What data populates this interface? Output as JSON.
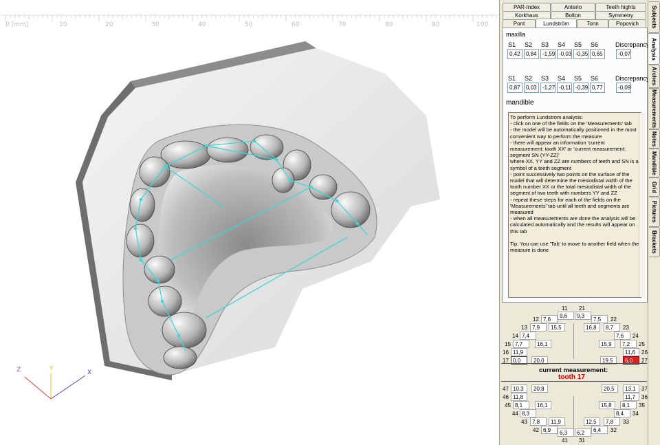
{
  "ruler": {
    "labels": [
      "0 [mm]",
      "10",
      "20",
      "30",
      "40",
      "50",
      "60",
      "70",
      "80",
      "90",
      "100"
    ]
  },
  "axes": {
    "z": "Z",
    "y": "Y",
    "x": "X"
  },
  "colors": {
    "panel_bg": "#ece9d8",
    "measure_line": "#3fd6d9",
    "highlight": "#e31b1b",
    "current_tooth": "#d00000"
  },
  "top_tabs": {
    "row1": [
      "PAR-Index",
      "Anterio",
      "Teeth hights"
    ],
    "row2": [
      "Korkhaus",
      "Bolton",
      "Symmetry"
    ],
    "row3": [
      "Pont",
      "Lundström",
      "Tonn",
      "Popovich"
    ]
  },
  "side_tabs": [
    "Subjects",
    "Analysis",
    "Arches",
    "Measurements",
    "Notes",
    "Mandible",
    "Grid",
    "Pictures",
    "Brackets"
  ],
  "maxilla": {
    "title": "maxilla",
    "headers": [
      "S1",
      "S2",
      "S3",
      "S4",
      "S5",
      "S6"
    ],
    "values": [
      "0,42",
      "0,84",
      "-1,59",
      "-0,03",
      "-0,35",
      "0,65"
    ],
    "discrepancy_label": "Discrepancy",
    "discrepancy": "-0,07"
  },
  "mandible_row": {
    "headers": [
      "S1",
      "S2",
      "S3",
      "S4",
      "S5",
      "S6"
    ],
    "values": [
      "0,87",
      "0,03",
      "-1,27",
      "-0,11",
      "-0,39",
      "0,77"
    ],
    "discrepancy_label": "Discrepancy",
    "discrepancy": "-0,09"
  },
  "mandible_title": "mandible",
  "instructions": "To perform Lundstrom analysis:\n- click on one of the fields on the 'Measurements' tab\n- the model will be automatically positioned in the most convenient way to perform the measure\n- there will appear an information 'current measurement: tooth XX' or 'current measurement: segment SN (YY-ZZ)'\nwhere XX, YY and ZZ are numbers of teeth and SN is a symbol of a teeth segment\n- point successively two points on the surface of the model that will determine the mesiodistal width of the tooth number XX or the total mesiodistal width of the segment of two teeth with numbers YY and ZZ\n- repeat these steps for each of the fields on the 'Measurements' tab until all teeth and segments are measured\n- when all measurements are done the analysis will be calculated automatically and the results will appear on this tab\n\nTip: You can use 'Tab' to move to another field when the measure is done",
  "upper_teeth": {
    "t11": "11",
    "t21": "21",
    "v11": "9,6",
    "v21": "9,3",
    "t12": "12",
    "v12": "7,6",
    "v22": "7,5",
    "t22": "22",
    "t13": "13",
    "v13": "7,9",
    "s13": "15,5",
    "s23": "16,8",
    "v23": "8,7",
    "t23": "23",
    "t14": "14",
    "v14": "7,4",
    "v24": "7,6",
    "t24": "24",
    "t15": "15",
    "v15": "7,7",
    "s15": "16,1",
    "s25": "15,9",
    "v25": "7,2",
    "t25": "25",
    "t16": "16",
    "v16": "11,9",
    "v26": "11,6",
    "t26": "26",
    "t17": "17",
    "v17": "0,0",
    "s17": "20,0",
    "s27": "19,5",
    "v27": "6,0",
    "t27": "27"
  },
  "current": {
    "label": "current measurement:",
    "value": "tooth 17"
  },
  "lower_teeth": {
    "t47": "47",
    "v47": "10,3",
    "s47": "20,8",
    "s37": "20,5",
    "v37": "13,1",
    "t37": "37",
    "t46": "46",
    "v46": "11,8",
    "v36": "11,7",
    "t36": "36",
    "t45": "45",
    "v45": "8,1",
    "s45": "16,1",
    "s35": "15,8",
    "v35": "8,1",
    "t35": "35",
    "t44": "44",
    "v44": "8,3",
    "v34": "8,4",
    "t34": "34",
    "t43": "43",
    "v43": "7,8",
    "s43": "11,9",
    "s33": "12,5",
    "v33": "7,8",
    "t33": "33",
    "t42": "42",
    "v42": "6,9",
    "v32": "6,4",
    "t32": "32",
    "v41": "6,3",
    "v31": "6,2",
    "t41": "41",
    "t31": "31"
  }
}
